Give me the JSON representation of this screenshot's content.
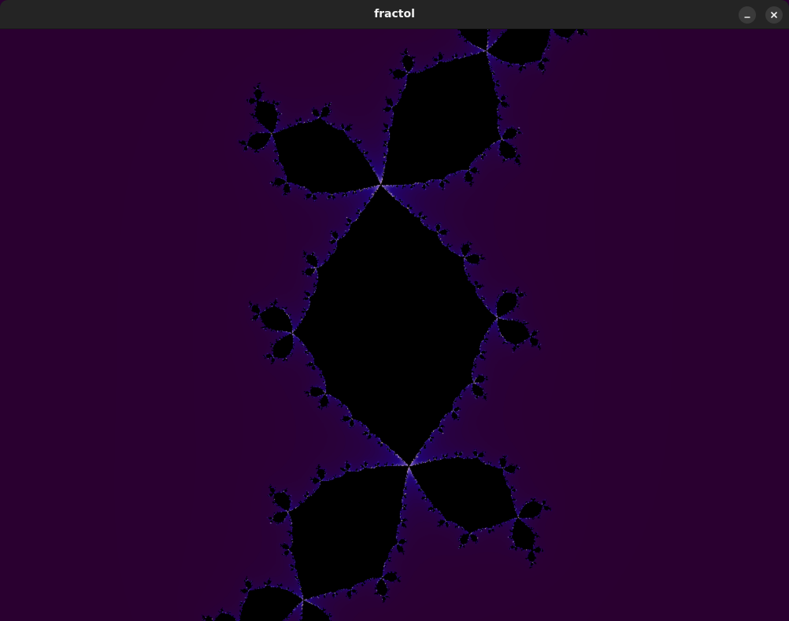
{
  "window": {
    "title": "fractol",
    "controls": [
      {
        "name": "minimize-button",
        "icon": "minimize-icon"
      },
      {
        "name": "close-button",
        "icon": "close-icon"
      }
    ]
  },
  "fractal": {
    "type": "julia",
    "palette": {
      "background": "#2a0030",
      "glow": "#1a10d0",
      "edge": "#ffd040",
      "interior": "#000000"
    }
  }
}
